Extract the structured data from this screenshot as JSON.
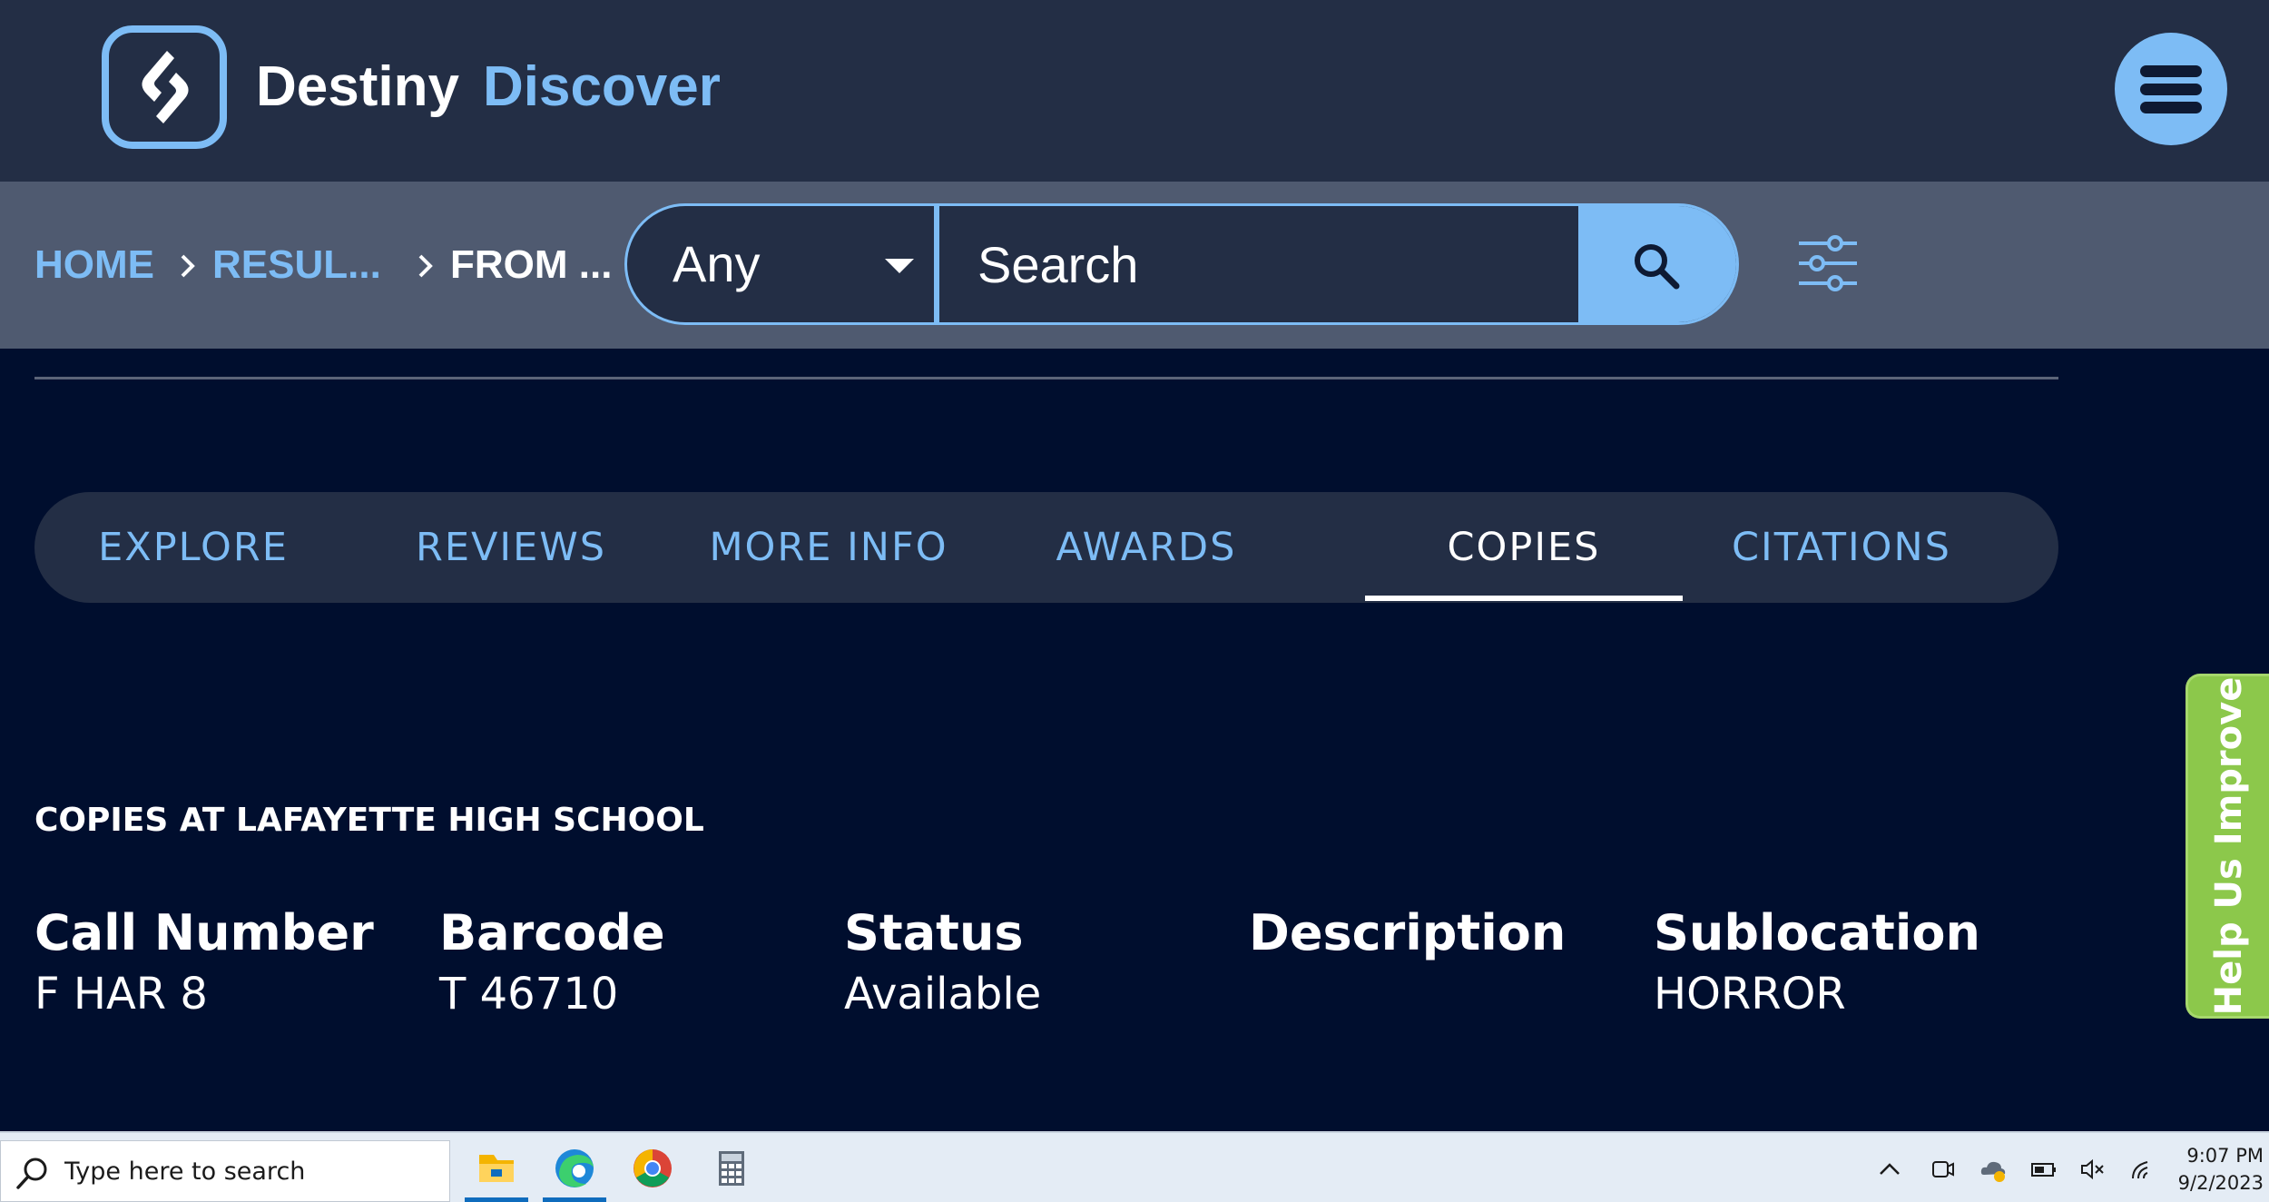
{
  "brand": {
    "name_primary": "Destiny",
    "name_secondary": "Discover"
  },
  "breadcrumb": [
    {
      "label": "HOME"
    },
    {
      "label": "RESUL..."
    },
    {
      "label": "FROM ..."
    }
  ],
  "search": {
    "scope_value": "Any",
    "placeholder": "Search"
  },
  "tabs": [
    {
      "label": "EXPLORE"
    },
    {
      "label": "REVIEWS"
    },
    {
      "label": "MORE INFO"
    },
    {
      "label": "AWARDS"
    },
    {
      "label": "COPIES",
      "active": true
    },
    {
      "label": "CITATIONS"
    }
  ],
  "copies": {
    "heading": "COPIES AT LAFAYETTE HIGH SCHOOL",
    "columns": [
      {
        "header": "Call Number",
        "value": "F HAR 8"
      },
      {
        "header": "Barcode",
        "value": "T 46710"
      },
      {
        "header": "Status",
        "value": "Available"
      },
      {
        "header": "Description",
        "value": ""
      },
      {
        "header": "Sublocation",
        "value": "HORROR"
      }
    ]
  },
  "help_tab": {
    "label": "Help Us Improve"
  },
  "taskbar": {
    "search_placeholder": "Type here to search",
    "time": "9:07 PM",
    "date": "9/2/2023"
  },
  "colors": {
    "header_bg": "#232e45",
    "navbar_bg": "#4f5a70",
    "page_bg": "#000e2e",
    "accent": "#7dbcf5",
    "help_green": "#8cc84b"
  },
  "icons": {
    "logo": "destiny-logo-icon",
    "menu": "hamburger-menu-icon",
    "breadcrumb_separator": "chevron-right-icon",
    "dropdown": "caret-down-icon",
    "search": "search-icon",
    "filter": "sliders-filter-icon"
  }
}
